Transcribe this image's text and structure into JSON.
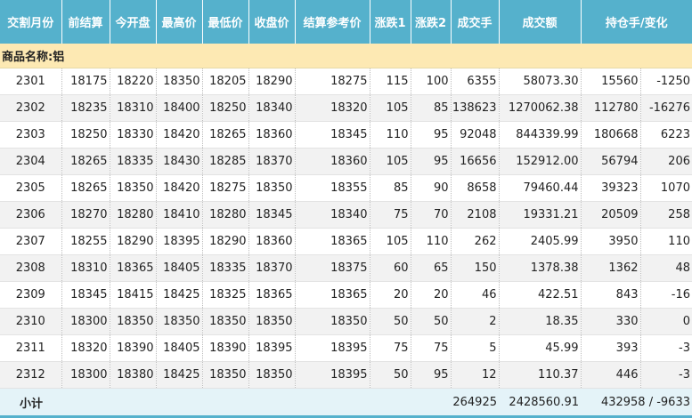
{
  "headers": [
    "交割月份",
    "前结算",
    "今开盘",
    "最高价",
    "最低价",
    "收盘价",
    "结算参考价",
    "涨跌1",
    "涨跌2",
    "成交手",
    "成交额",
    "持仓手/变化"
  ],
  "category_label": "商品名称:铝",
  "rows": [
    [
      "2301",
      "18175",
      "18220",
      "18350",
      "18205",
      "18290",
      "18275",
      "115",
      "100",
      "6355",
      "58073.30",
      "15560",
      "-1250"
    ],
    [
      "2302",
      "18235",
      "18310",
      "18400",
      "18250",
      "18340",
      "18320",
      "105",
      "85",
      "138623",
      "1270062.38",
      "112780",
      "-16276"
    ],
    [
      "2303",
      "18250",
      "18330",
      "18420",
      "18265",
      "18360",
      "18345",
      "110",
      "95",
      "92048",
      "844339.99",
      "180668",
      "6223"
    ],
    [
      "2304",
      "18265",
      "18335",
      "18430",
      "18285",
      "18370",
      "18360",
      "105",
      "95",
      "16656",
      "152912.00",
      "56794",
      "206"
    ],
    [
      "2305",
      "18265",
      "18350",
      "18420",
      "18275",
      "18350",
      "18355",
      "85",
      "90",
      "8658",
      "79460.44",
      "39323",
      "1070"
    ],
    [
      "2306",
      "18270",
      "18280",
      "18410",
      "18280",
      "18345",
      "18340",
      "75",
      "70",
      "2108",
      "19331.21",
      "20509",
      "258"
    ],
    [
      "2307",
      "18255",
      "18290",
      "18395",
      "18290",
      "18360",
      "18365",
      "105",
      "110",
      "262",
      "2405.99",
      "3950",
      "110"
    ],
    [
      "2308",
      "18310",
      "18365",
      "18405",
      "18335",
      "18370",
      "18375",
      "60",
      "65",
      "150",
      "1378.38",
      "1362",
      "48"
    ],
    [
      "2309",
      "18345",
      "18415",
      "18425",
      "18325",
      "18365",
      "18365",
      "20",
      "20",
      "46",
      "422.51",
      "843",
      "-16"
    ],
    [
      "2310",
      "18300",
      "18350",
      "18350",
      "18350",
      "18350",
      "18350",
      "50",
      "50",
      "2",
      "18.35",
      "330",
      "0"
    ],
    [
      "2311",
      "18320",
      "18390",
      "18405",
      "18390",
      "18395",
      "18395",
      "75",
      "75",
      "5",
      "45.99",
      "393",
      "-3"
    ],
    [
      "2312",
      "18300",
      "18380",
      "18425",
      "18350",
      "18350",
      "18395",
      "50",
      "95",
      "12",
      "110.37",
      "446",
      "-3"
    ]
  ],
  "subtotal": {
    "label": "小计",
    "volume": "264925",
    "turnover": "2428560.91",
    "open_interest": "432958 / -9633"
  }
}
